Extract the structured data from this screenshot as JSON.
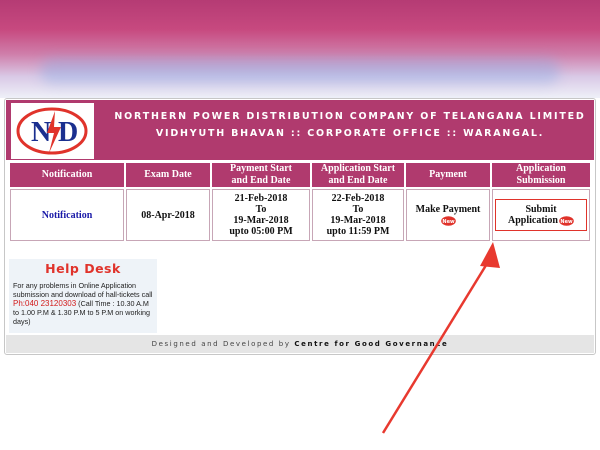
{
  "header": {
    "logo_text": "N D",
    "company": "NORTHERN POWER DISTRIBUTION COMPANY OF TELANGANA LIMITED",
    "office": "VIDHYUTH BHAVAN :: CORPORATE OFFICE :: WARANGAL."
  },
  "table": {
    "headers": [
      {
        "line1": "Notification",
        "line2": ""
      },
      {
        "line1": "Exam Date",
        "line2": ""
      },
      {
        "line1": "Payment Start",
        "line2": "and End Date"
      },
      {
        "line1": "Application Start",
        "line2": "and End Date"
      },
      {
        "line1": "Payment",
        "line2": ""
      },
      {
        "line1": "Application Submission",
        "line2": ""
      }
    ],
    "row": {
      "notification": "Notification",
      "exam_date": "08-Apr-2018",
      "payment_start": "21-Feb-2018",
      "payment_to": "To",
      "payment_end": "19-Mar-2018",
      "payment_time": "upto 05:00 PM",
      "app_start": "22-Feb-2018",
      "app_to": "To",
      "app_end": "19-Mar-2018",
      "app_time": "upto 11:59 PM",
      "make_payment": "Make Payment",
      "submit_application": "Submit Application",
      "new_badge": "New"
    }
  },
  "helpdesk": {
    "title": "Help Desk",
    "line1": "For any problems in Online Application submission and download of hall-tickets call",
    "phone": "Ph:040 23120303",
    "hours": "(Call Time : 10.30 A.M to 1.00 P.M & 1.30 P.M to 5 P.M on working days)"
  },
  "footer": {
    "prefix": "Designed and Developed by",
    "org": "Centre for Good Governance"
  },
  "colors": {
    "header": "#b03a6e",
    "accent_red": "#e0332b",
    "link_blue": "#1a1aa8"
  }
}
